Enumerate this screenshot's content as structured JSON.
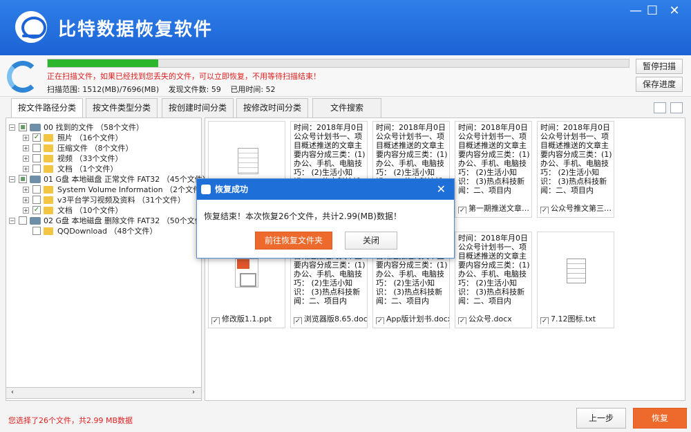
{
  "app": {
    "title": "比特数据恢复软件"
  },
  "window": {
    "minimize": "—",
    "maximize": "☐",
    "close": "✕"
  },
  "scan": {
    "progress": 0.19,
    "message": "正在扫描文件，如果已经找到您丢失的文件，可以立即恢复，不用等待扫描结束！",
    "range": "扫描范围: 1512(MB)/7696(MB)",
    "found": "发现文件数: 59",
    "elapsed": "已用时间: 52",
    "pause_label": "暂停扫描",
    "save_label": "保存进度"
  },
  "tabs": [
    "按文件路径分类",
    "按文件类型分类",
    "按创建时间分类",
    "按修改时间分类",
    "文件搜索"
  ],
  "tree": [
    {
      "text": "00 找到的文件 （58个文件）",
      "level": 0,
      "type": "drive",
      "checked": "partial"
    },
    {
      "text": "照片 （16个文件）",
      "level": 1,
      "type": "folder",
      "checked": "yes"
    },
    {
      "text": "压缩文件 （8个文件）",
      "level": 1,
      "type": "folder",
      "checked": "no"
    },
    {
      "text": "视频 （33个文件）",
      "level": 1,
      "type": "folder",
      "checked": "no"
    },
    {
      "text": "文档 （1个文件）",
      "level": 1,
      "type": "folder",
      "checked": "no"
    },
    {
      "text": "01 G盘 本地磁盘 正常文件 FAT32 （45个文件）",
      "level": 0,
      "type": "drive",
      "checked": "partial"
    },
    {
      "text": "System Volume Information （2个文件）",
      "level": 1,
      "type": "folder",
      "checked": "no"
    },
    {
      "text": "v3平台学习视频及资料 （31个文件）",
      "level": 1,
      "type": "folder",
      "checked": "no"
    },
    {
      "text": "文档 （10个文件）",
      "level": 1,
      "type": "folder",
      "checked": "yes"
    },
    {
      "text": "02 G盘 本地磁盘 删除文件 FAT32 （50个文件）",
      "level": 0,
      "type": "drive",
      "checked": "no"
    },
    {
      "text": "QQDownload （48个文件）",
      "level": 1,
      "type": "folder",
      "checked": "no"
    }
  ],
  "preview_text": "时间：2018年月0日公众号计划书一、项目概述推送的文章主要内容分成三类：(1)办公、手机、电脑技巧： (2)生活小知识： (3)热点科技新闻：二、项目内",
  "files_row1": [
    {
      "name": "",
      "kind": "doc"
    },
    {
      "name": "",
      "kind": "text"
    },
    {
      "name": "",
      "kind": "text"
    },
    {
      "name": "第一期推送文章…",
      "kind": "text"
    },
    {
      "name": "公众号推文第三…",
      "kind": "text"
    }
  ],
  "files_row2": [
    {
      "name": "修改版1.1.ppt",
      "kind": "ppt"
    },
    {
      "name": "浏览器版8.65.docx",
      "kind": "text"
    },
    {
      "name": "App版计划书.docx",
      "kind": "text"
    },
    {
      "name": "公众号.docx",
      "kind": "text"
    },
    {
      "name": "7.12图标.txt",
      "kind": "txt"
    }
  ],
  "dialog": {
    "title": "恢复成功",
    "message": "恢复结束！本次恢复26个文件，共计2.99(MB)数据！",
    "open_folder": "前往恢复文件夹",
    "close": "关闭"
  },
  "footer": {
    "selection": "您选择了26个文件，共2.99 MB数据",
    "prev": "上一步",
    "recover": "恢复"
  },
  "colors": {
    "brand": "#1f6fd8",
    "accent": "#ee6a2c",
    "alert": "#e02020"
  }
}
